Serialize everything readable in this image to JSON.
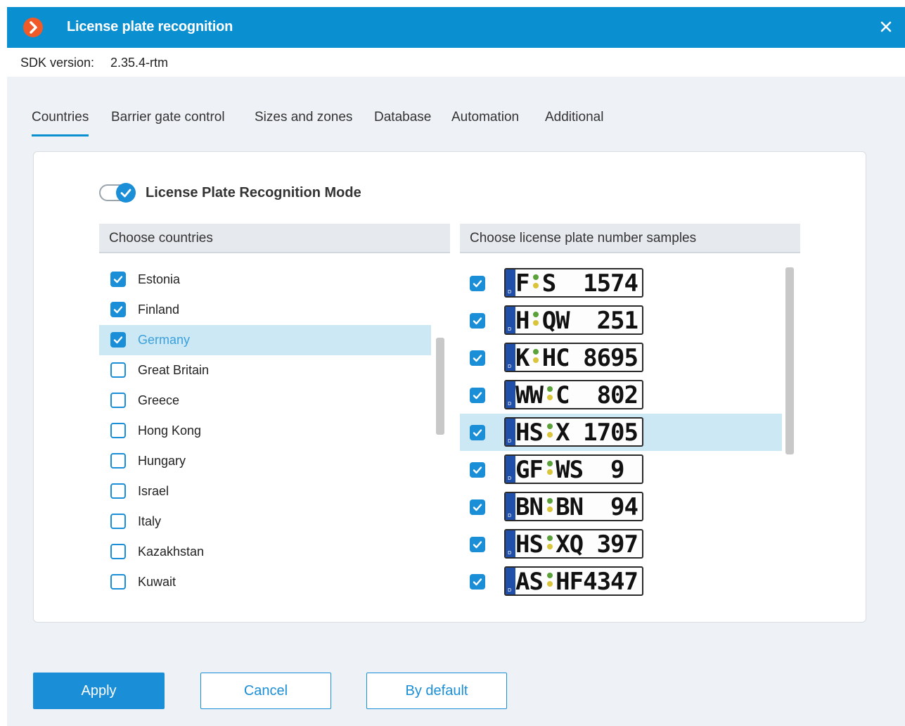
{
  "window": {
    "title": "License plate recognition",
    "close_icon": "close-icon",
    "logo_icon": "app-logo-icon"
  },
  "sdk": {
    "label": "SDK version:",
    "value": "2.35.4-rtm"
  },
  "tabs": [
    {
      "label": "Countries",
      "active": true
    },
    {
      "label": "Barrier gate control",
      "active": false
    },
    {
      "label": "Sizes and zones",
      "active": false
    },
    {
      "label": "Database",
      "active": false
    },
    {
      "label": "Automation",
      "active": false
    },
    {
      "label": "Additional",
      "active": false
    }
  ],
  "mode_toggle": {
    "label": "License Plate Recognition Mode",
    "on": true
  },
  "countries": {
    "header": "Choose countries",
    "items": [
      {
        "label": "Estonia",
        "checked": true,
        "selected": false
      },
      {
        "label": "Finland",
        "checked": true,
        "selected": false
      },
      {
        "label": "Germany",
        "checked": true,
        "selected": true
      },
      {
        "label": "Great Britain",
        "checked": false,
        "selected": false
      },
      {
        "label": "Greece",
        "checked": false,
        "selected": false
      },
      {
        "label": "Hong Kong",
        "checked": false,
        "selected": false
      },
      {
        "label": "Hungary",
        "checked": false,
        "selected": false
      },
      {
        "label": "Israel",
        "checked": false,
        "selected": false
      },
      {
        "label": "Italy",
        "checked": false,
        "selected": false
      },
      {
        "label": "Kazakhstan",
        "checked": false,
        "selected": false
      },
      {
        "label": "Kuwait",
        "checked": false,
        "selected": false
      }
    ]
  },
  "samples": {
    "header": "Choose license plate number samples",
    "items": [
      {
        "region": "F",
        "number": "S  1574",
        "checked": true,
        "selected": false
      },
      {
        "region": "H",
        "number": "QW  251",
        "checked": true,
        "selected": false
      },
      {
        "region": "K",
        "number": "HC 8695",
        "checked": true,
        "selected": false
      },
      {
        "region": "WW",
        "number": "C  802",
        "checked": true,
        "selected": false
      },
      {
        "region": "HS",
        "number": "X 1705",
        "checked": true,
        "selected": true
      },
      {
        "region": "GF",
        "number": "WS  9 ",
        "checked": true,
        "selected": false
      },
      {
        "region": "BN",
        "number": "BN  94",
        "checked": true,
        "selected": false
      },
      {
        "region": "HS",
        "number": "XQ 397",
        "checked": true,
        "selected": false
      },
      {
        "region": "AS",
        "number": "HF4347",
        "checked": true,
        "selected": false
      }
    ]
  },
  "buttons": {
    "apply": "Apply",
    "cancel": "Cancel",
    "default": "By default"
  },
  "colors": {
    "accent": "#1a8ed6",
    "titlebar": "#0a8fd1",
    "logo": "#f05a28",
    "selection": "#cde8f5"
  }
}
